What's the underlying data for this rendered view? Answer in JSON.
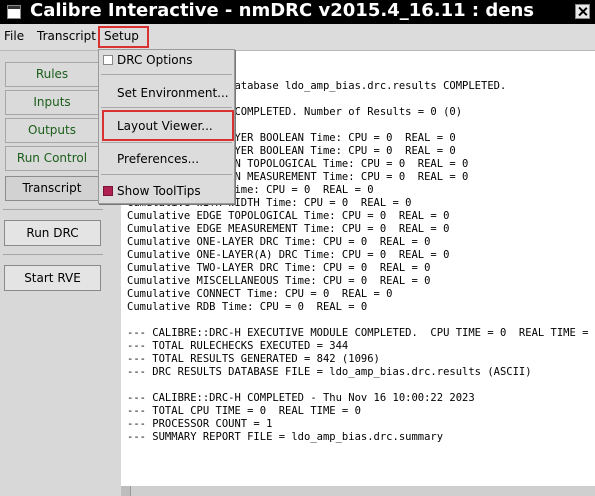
{
  "window": {
    "title": "Calibre Interactive - nmDRC v2015.4_16.11 : dens"
  },
  "menubar": {
    "file": "File",
    "transcript": "Transcript",
    "setup": "Setup"
  },
  "setup_menu": {
    "drc_options": "DRC Options",
    "set_environment": "Set Environment...",
    "layout_viewer": "Layout Viewer...",
    "preferences": "Preferences...",
    "show_tooltips": "Show ToolTips",
    "drc_options_checked": false,
    "show_tooltips_checked": true
  },
  "sidebar": {
    "rules": "Rules",
    "inputs": "Inputs",
    "outputs": "Outputs",
    "run_control": "Run Control",
    "transcript": "Transcript",
    "run_drc": "Run DRC",
    "start_rve": "Start RVE"
  },
  "transcript_lines": [
    "--- DRC Results Database ldo_amp_bias.drc.results COMPLETED.",
    "",
    "--- CHKT2DUMCK_4 COMPLETED. Number of Results = 0 (0)",
    "",
    "Cumulative ONE-LAYER BOOLEAN Time: CPU = 0  REAL = 0",
    "Cumulative TWO-LAYER BOOLEAN Time: CPU = 0  REAL = 0",
    "Cumulative POLYGON TOPOLOGICAL Time: CPU = 0  REAL = 0",
    "Cumulative POLYGON MEASUREMENT Time: CPU = 0  REAL = 0",
    "Cumulative SIZE Time: CPU = 0  REAL = 0",
    "Cumulative WITH WIDTH Time: CPU = 0  REAL = 0",
    "Cumulative EDGE TOPOLOGICAL Time: CPU = 0  REAL = 0",
    "Cumulative EDGE MEASUREMENT Time: CPU = 0  REAL = 0",
    "Cumulative ONE-LAYER DRC Time: CPU = 0  REAL = 0",
    "Cumulative ONE-LAYER(A) DRC Time: CPU = 0  REAL = 0",
    "Cumulative TWO-LAYER DRC Time: CPU = 0  REAL = 0",
    "Cumulative MISCELLANEOUS Time: CPU = 0  REAL = 0",
    "Cumulative CONNECT Time: CPU = 0  REAL = 0",
    "Cumulative RDB Time: CPU = 0  REAL = 0",
    "",
    "--- CALIBRE::DRC-H EXECUTIVE MODULE COMPLETED.  CPU TIME = 0  REAL TIME = 0",
    "--- TOTAL RULECHECKS EXECUTED = 344",
    "--- TOTAL RESULTS GENERATED = 842 (1096)",
    "--- DRC RESULTS DATABASE FILE = ldo_amp_bias.drc.results (ASCII)",
    "",
    "--- CALIBRE::DRC-H COMPLETED - Thu Nov 16 10:00:22 2023",
    "--- TOTAL CPU TIME = 0  REAL TIME = 0",
    "--- PROCESSOR COUNT = 1",
    "--- SUMMARY REPORT FILE = ldo_amp_bias.drc.summary"
  ]
}
